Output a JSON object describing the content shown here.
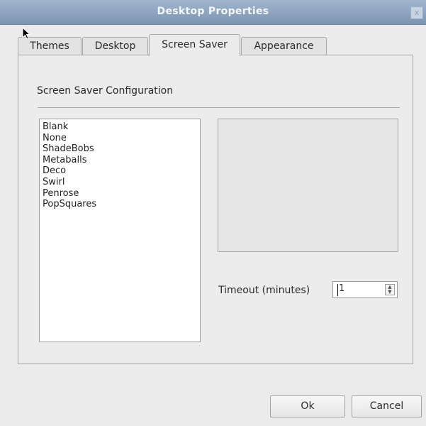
{
  "window": {
    "title": "Desktop Properties",
    "close_glyph": "x"
  },
  "tabs": [
    {
      "label": "Themes",
      "active": false
    },
    {
      "label": "Desktop",
      "active": false
    },
    {
      "label": "Screen Saver",
      "active": true
    },
    {
      "label": "Appearance",
      "active": false
    }
  ],
  "screensaver": {
    "section_title": "Screen Saver Configuration",
    "items": [
      "Blank",
      "None",
      "ShadeBobs",
      "Metaballs",
      "Deco",
      "Swirl",
      "Penrose",
      "PopSquares"
    ],
    "timeout_label": "Timeout (minutes)",
    "timeout_value": "1"
  },
  "buttons": {
    "ok": "Ok",
    "cancel": "Cancel"
  },
  "icons": {
    "close": "close-icon",
    "cursor": "cursor-icon",
    "spin": "spinner-arrows-icon"
  },
  "colors": {
    "titlebar": "#8aa0bd",
    "background": "#ebebeb"
  }
}
